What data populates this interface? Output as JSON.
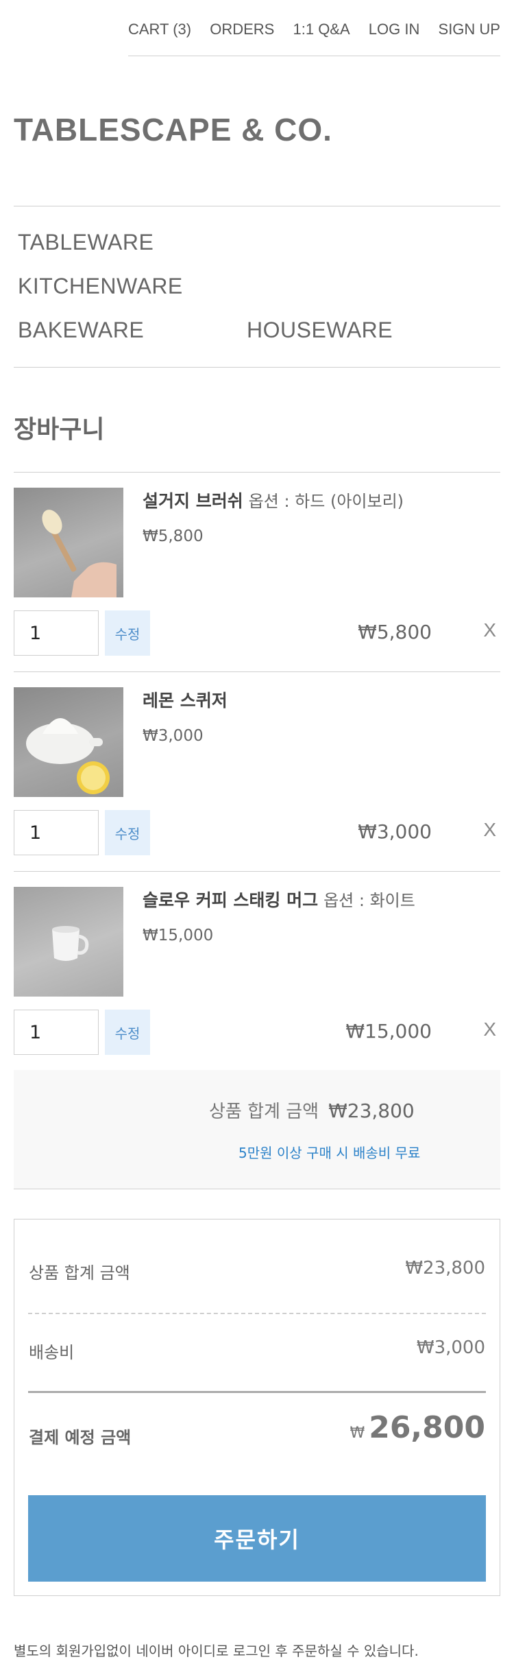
{
  "topnav": {
    "cart": "CART (3)",
    "orders": "ORDERS",
    "qna": "1:1 Q&A",
    "login": "LOG IN",
    "signup": "SIGN UP"
  },
  "brand": "TABLESCAPE & CO.",
  "categories": [
    "TABLEWARE",
    "KITCHENWARE",
    "BAKEWARE",
    "HOUSEWARE"
  ],
  "page_title": "장바구니",
  "cart_items": [
    {
      "name": "설거지 브러쉬",
      "option": "옵션 : 하드 (아이보리)",
      "unit_price": "₩5,800",
      "qty": "1",
      "edit_label": "수정",
      "line_total": "₩5,800",
      "remove": "X"
    },
    {
      "name": "레몬 스퀴저",
      "option": "",
      "unit_price": "₩3,000",
      "qty": "1",
      "edit_label": "수정",
      "line_total": "₩3,000",
      "remove": "X"
    },
    {
      "name": "슬로우 커피 스태킹 머그",
      "option": "옵션 : 화이트",
      "unit_price": "₩15,000",
      "qty": "1",
      "edit_label": "수정",
      "line_total": "₩15,000",
      "remove": "X"
    }
  ],
  "summary_bar": {
    "label": "상품 합계 금액",
    "value": "₩23,800",
    "note": "5만원 이상 구매 시 배송비 무료"
  },
  "order_box": {
    "subtotal_label": "상품 합계 금액",
    "subtotal_value": "₩23,800",
    "shipping_label": "배송비",
    "shipping_value": "₩3,000",
    "total_label": "결제 예정 금액",
    "total_currency": "₩",
    "total_value": "26,800",
    "order_button": "주문하기"
  },
  "footer_note": "별도의 회원가입없이 네이버 아이디로 로그인 후 주문하실 수 있습니다.",
  "colors": {
    "accent_button": "#5b9ecf",
    "edit_bg": "#e5f0fb",
    "note_blue": "#2c82c9"
  }
}
